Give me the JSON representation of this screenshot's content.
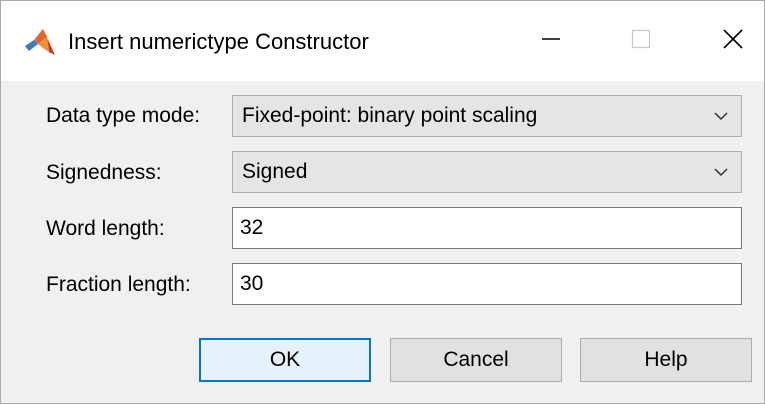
{
  "window": {
    "title": "Insert numerictype Constructor"
  },
  "form": {
    "data_type_mode": {
      "label": "Data type mode:",
      "value": "Fixed-point: binary point scaling"
    },
    "signedness": {
      "label": "Signedness:",
      "value": "Signed"
    },
    "word_length": {
      "label": "Word length:",
      "value": "32"
    },
    "fraction_length": {
      "label": "Fraction length:",
      "value": "30"
    }
  },
  "buttons": {
    "ok": "OK",
    "cancel": "Cancel",
    "help": "Help"
  },
  "icons": {
    "app": "matlab-logo-icon",
    "minimize": "minimize-icon",
    "maximize": "maximize-icon",
    "close": "close-icon",
    "chevron": "chevron-down-icon"
  },
  "colors": {
    "ok_button_border": "#0078d7",
    "ok_button_background": "#e5f1fb",
    "button_background": "#e1e1e1",
    "select_background": "#e5e5e5",
    "dialog_background": "#f0f0f0"
  }
}
